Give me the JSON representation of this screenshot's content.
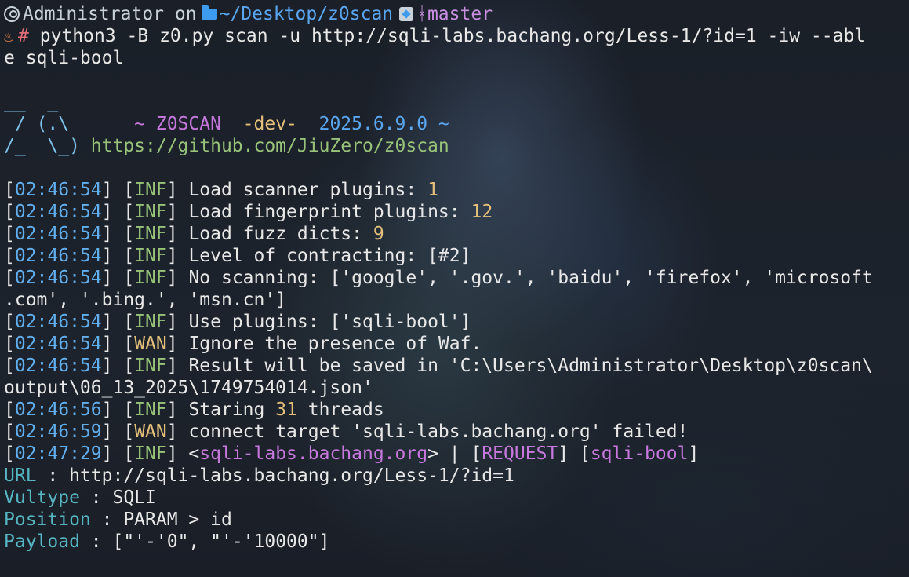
{
  "prompt": {
    "user": "Administrator",
    "on": "on",
    "path": "~/Desktop/z0scan",
    "branch": "master",
    "hash": "#",
    "command_1": "python3 -B z0.py scan -u http://sqli-labs.bachang.org/Less-1/?id=1 -iw --abl",
    "command_2": "e sqli-bool"
  },
  "banner": {
    "line1": "__  _",
    "line2_art": " / (.\\      ",
    "name": "~ Z0SCAN",
    "tag": "-dev-",
    "version": "2025.6.9.0 ~",
    "line3_art": "/_  \\_) ",
    "url": "https://github.com/JiuZero/z0scan"
  },
  "logs": [
    {
      "time": "02:46:54",
      "level": "INF",
      "text": "Load scanner plugins: ",
      "num": "1"
    },
    {
      "time": "02:46:54",
      "level": "INF",
      "text": "Load fingerprint plugins: ",
      "num": "12"
    },
    {
      "time": "02:46:54",
      "level": "INF",
      "text": "Load fuzz dicts: ",
      "num": "9"
    },
    {
      "time": "02:46:54",
      "level": "INF",
      "text": "Level of contracting: [#2]",
      "num": ""
    },
    {
      "time": "02:46:54",
      "level": "INF",
      "text": "No scanning: ['google', '.gov.', 'baidu', 'firefox', 'microsoft",
      "num": ""
    },
    {
      "time": "",
      "level": "",
      "text": ".com', '.bing.', 'msn.cn']",
      "num": ""
    },
    {
      "time": "02:46:54",
      "level": "INF",
      "text": "Use plugins: ['sqli-bool']",
      "num": ""
    },
    {
      "time": "02:46:54",
      "level": "WAN",
      "text": "Ignore the presence of Waf.",
      "num": ""
    },
    {
      "time": "02:46:54",
      "level": "INF",
      "text": "Result will be saved in 'C:\\Users\\Administrator\\Desktop\\z0scan\\",
      "num": ""
    },
    {
      "time": "",
      "level": "",
      "text": "output\\06_13_2025\\1749754014.json'",
      "num": ""
    },
    {
      "time": "02:46:56",
      "level": "INF",
      "text": "Staring ",
      "num": "31",
      "suffix": " threads"
    },
    {
      "time": "02:46:59",
      "level": "WAN",
      "text": "connect target 'sqli-labs.bachang.org' failed!",
      "num": ""
    }
  ],
  "finding": {
    "time": "02:47:29",
    "level": "INF",
    "host": "sqli-labs.bachang.org",
    "type_label": "REQUEST",
    "plugin": "sqli-bool",
    "url_key": "URL",
    "url_val": "http://sqli-labs.bachang.org/Less-1/?id=1",
    "vultype_key": "Vultype",
    "vultype_val": "SQLI",
    "position_key": "Position",
    "position_val": "PARAM > id",
    "payload_key": "Payload",
    "payload_val": "[\"'-'0\", \"'-'10000\"]"
  }
}
